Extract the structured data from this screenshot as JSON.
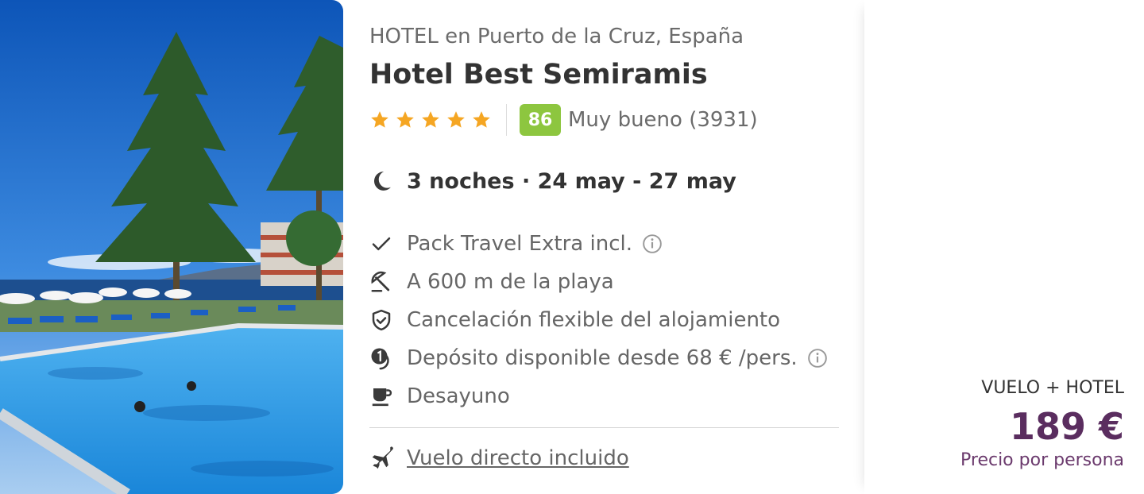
{
  "hotel": {
    "subtitle": "HOTEL en Puerto de la Cruz, España",
    "name": "Hotel Best Semiramis",
    "stars": 5,
    "score": "86",
    "score_label": "Muy bueno (3931)"
  },
  "stay": {
    "dates": "3 noches · 24 may - 27 may"
  },
  "features": [
    {
      "icon": "check-icon",
      "text": "Pack Travel Extra incl.",
      "info": true
    },
    {
      "icon": "beach-umbrella-icon",
      "text": "A 600 m de la playa",
      "info": false
    },
    {
      "icon": "shield-check-icon",
      "text": "Cancelación flexible del alojamiento",
      "info": false
    },
    {
      "icon": "deposit-icon",
      "text": "Depósito disponible desde 68 € /pers.",
      "info": true
    },
    {
      "icon": "coffee-cup-icon",
      "text": "Desayuno",
      "info": false
    }
  ],
  "flight": {
    "icon": "plane-icon",
    "text": "Vuelo directo incluido"
  },
  "price": {
    "package_label": "VUELO + HOTEL",
    "amount": "189 €",
    "per_person": "Precio por persona"
  },
  "colors": {
    "star": "#f5a623",
    "score_badge": "#8dc63f",
    "price": "#5a2d5f",
    "icon": "#3a3a3a"
  }
}
